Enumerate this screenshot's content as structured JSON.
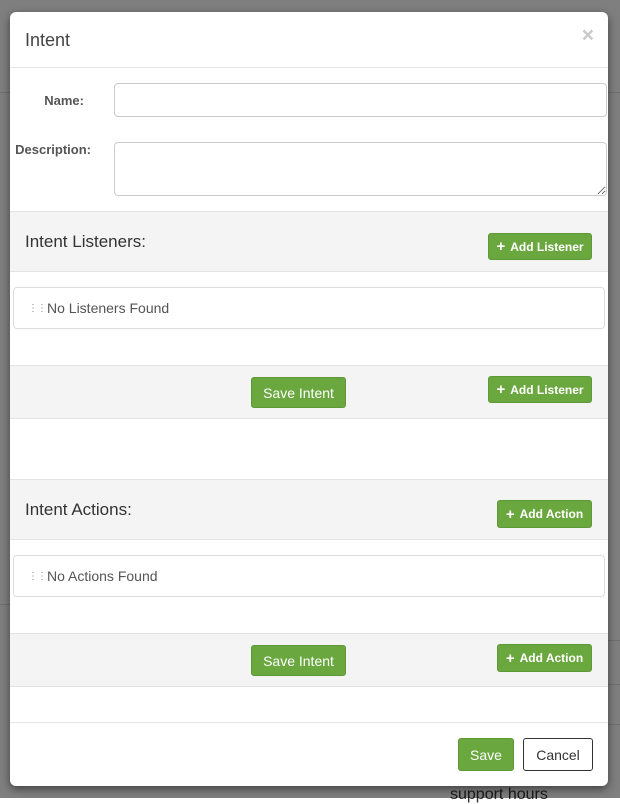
{
  "modal": {
    "title": "Intent",
    "close_glyph": "×",
    "name_label": "Name:",
    "name_value": "",
    "description_label": "Description:",
    "description_value": ""
  },
  "listeners": {
    "title": "Intent Listeners:",
    "add_label": "Add Listener",
    "empty_text": "No Listeners Found",
    "save_intent_label": "Save Intent"
  },
  "actions": {
    "title": "Intent Actions:",
    "add_label": "Add Action",
    "empty_text": "No Actions Found",
    "save_intent_label": "Save Intent"
  },
  "footer": {
    "save_label": "Save",
    "cancel_label": "Cancel"
  },
  "icons": {
    "plus": "plus-icon",
    "drag": "drag-handle-icon",
    "close": "close-icon"
  },
  "colors": {
    "accent_green": "#6aa83f",
    "section_bg": "#f4f4f4",
    "overlay": "rgba(0,0,0,0.5)"
  },
  "background_text": {
    "frag_1": "support hours"
  }
}
